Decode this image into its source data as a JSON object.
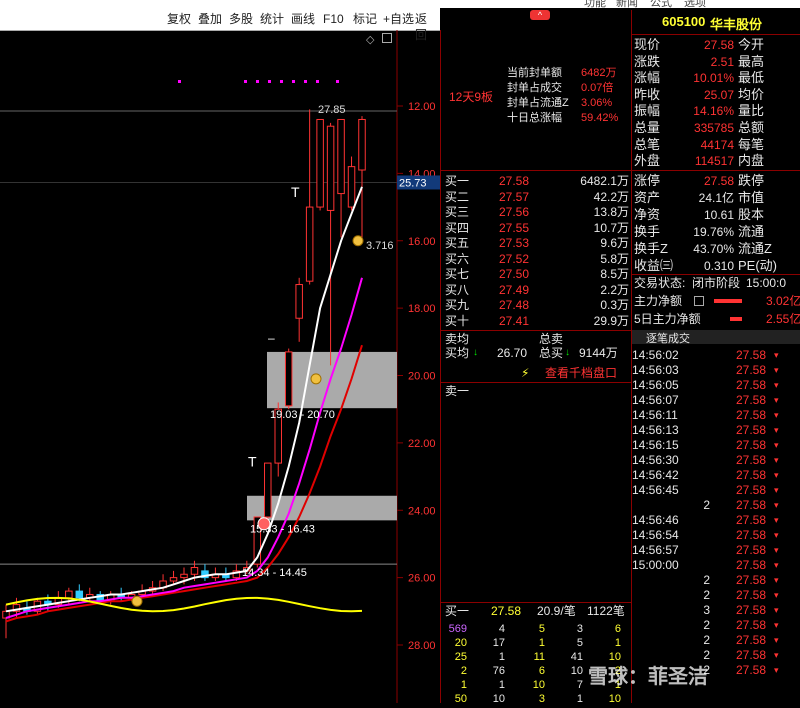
{
  "top_menu": [
    "功能",
    "新闻",
    "公式",
    "选项"
  ],
  "toolbar": {
    "items": [
      "复权",
      "叠加",
      "多股",
      "统计",
      "画线",
      "F10",
      "标记",
      "+自选",
      "返回"
    ]
  },
  "chart": {
    "y_ticks": [
      "28.00",
      "26.00",
      "24.00",
      "22.00",
      "20.00",
      "18.00",
      "16.00",
      "14.00",
      "12.00"
    ],
    "current_price_tag": "25.73",
    "high_label": "27.85",
    "label_3716": "3.716",
    "zone1_label": "19.03 - 20.70",
    "zone2_label": "15.33 - 16.43",
    "zone3_label": "14.34 - 14.45",
    "marker_T": "T",
    "marker_dash": "–",
    "glyph_diamond": "◇",
    "glyph_caret": "^"
  },
  "chart_data": {
    "type": "candlestick",
    "ylim": [
      11.5,
      29
    ],
    "y_ticks": [
      12,
      14,
      16,
      18,
      20,
      22,
      24,
      26,
      28
    ],
    "candles": [
      [
        12.8,
        13.0,
        12.2,
        13.2
      ],
      [
        13.0,
        13.2,
        12.8,
        13.4
      ],
      [
        13.1,
        13.0,
        12.9,
        13.3
      ],
      [
        13.0,
        13.3,
        12.9,
        13.4
      ],
      [
        13.3,
        13.2,
        13.0,
        13.5
      ],
      [
        13.2,
        13.4,
        13.1,
        13.6
      ],
      [
        13.4,
        13.6,
        13.2,
        13.7
      ],
      [
        13.6,
        13.4,
        13.3,
        13.8
      ],
      [
        13.4,
        13.5,
        13.3,
        13.7
      ],
      [
        13.5,
        13.3,
        13.2,
        13.6
      ],
      [
        13.3,
        13.5,
        13.2,
        13.6
      ],
      [
        13.5,
        13.4,
        13.3,
        13.7
      ],
      [
        13.4,
        13.5,
        13.3,
        13.6
      ],
      [
        13.5,
        13.6,
        13.4,
        13.8
      ],
      [
        13.6,
        13.7,
        13.5,
        13.9
      ],
      [
        13.7,
        13.9,
        13.6,
        14.1
      ],
      [
        13.9,
        14.0,
        13.8,
        14.2
      ],
      [
        14.0,
        14.1,
        13.8,
        14.3
      ],
      [
        14.1,
        14.3,
        13.9,
        14.5
      ],
      [
        14.2,
        14.0,
        13.9,
        14.4
      ],
      [
        14.0,
        14.1,
        13.9,
        14.3
      ],
      [
        14.1,
        14.0,
        13.9,
        14.3
      ],
      [
        14.0,
        14.2,
        13.9,
        14.4
      ],
      [
        14.2,
        14.3,
        14.1,
        14.5
      ],
      [
        14.4,
        15.8,
        14.3,
        15.8
      ],
      [
        15.8,
        17.4,
        15.7,
        17.4
      ],
      [
        17.4,
        19.0,
        17.0,
        19.2
      ],
      [
        19.1,
        20.7,
        19.0,
        20.8
      ],
      [
        21.7,
        22.7,
        21.0,
        22.9
      ],
      [
        22.8,
        25.0,
        22.7,
        27.9
      ],
      [
        25.0,
        27.6,
        24.9,
        27.6
      ],
      [
        24.9,
        27.4,
        20.3,
        27.5
      ],
      [
        25.4,
        27.6,
        24.1,
        27.6
      ],
      [
        25.0,
        26.2,
        24.9,
        26.5
      ],
      [
        26.1,
        27.6,
        24.0,
        27.7
      ]
    ],
    "ma_white": [
      13.0,
      13.05,
      13.1,
      13.15,
      13.2,
      13.25,
      13.3,
      13.35,
      13.4,
      13.45,
      13.5,
      13.5,
      13.55,
      13.6,
      13.65,
      13.7,
      13.8,
      13.9,
      14.0,
      14.05,
      14.1,
      14.1,
      14.15,
      14.2,
      14.6,
      15.3,
      16.2,
      17.3,
      18.6,
      20.3,
      22.0,
      23.0,
      24.0,
      24.8,
      25.6
    ],
    "ma_magenta": [
      12.8,
      12.9,
      13.0,
      13.05,
      13.1,
      13.15,
      13.2,
      13.25,
      13.3,
      13.3,
      13.35,
      13.4,
      13.4,
      13.45,
      13.5,
      13.55,
      13.6,
      13.7,
      13.75,
      13.8,
      13.85,
      13.9,
      13.95,
      14.0,
      14.2,
      14.6,
      15.2,
      15.9,
      16.8,
      17.8,
      18.9,
      19.9,
      20.8,
      21.8,
      22.9
    ],
    "ma_red": [
      12.7,
      12.8,
      12.85,
      12.9,
      13.0,
      13.05,
      13.1,
      13.15,
      13.2,
      13.25,
      13.3,
      13.3,
      13.35,
      13.4,
      13.45,
      13.5,
      13.55,
      13.6,
      13.65,
      13.7,
      13.75,
      13.8,
      13.85,
      13.9,
      14.0,
      14.3,
      14.7,
      15.2,
      15.8,
      16.5,
      17.3,
      18.2,
      19.0,
      19.9,
      20.9
    ]
  },
  "mid": {
    "board_days": "12天9板",
    "info": [
      {
        "label": "当前封单额",
        "value": "6482万"
      },
      {
        "label": "封单占成交",
        "value": "0.07倍"
      },
      {
        "label": "封单占流通Z",
        "value": "3.06%"
      },
      {
        "label": "十日总涨幅",
        "value": "59.42%"
      }
    ],
    "bids": [
      {
        "name": "买一",
        "price": "27.58",
        "vol": "6482.1万"
      },
      {
        "name": "买二",
        "price": "27.57",
        "vol": "42.2万"
      },
      {
        "name": "买三",
        "price": "27.56",
        "vol": "13.8万"
      },
      {
        "name": "买四",
        "price": "27.55",
        "vol": "10.7万"
      },
      {
        "name": "买五",
        "price": "27.53",
        "vol": "9.6万"
      },
      {
        "name": "买六",
        "price": "27.52",
        "vol": "5.8万"
      },
      {
        "name": "买七",
        "price": "27.50",
        "vol": "8.5万"
      },
      {
        "name": "买八",
        "price": "27.49",
        "vol": "2.2万"
      },
      {
        "name": "买九",
        "price": "27.48",
        "vol": "0.3万"
      },
      {
        "name": "买十",
        "price": "27.41",
        "vol": "29.9万"
      }
    ],
    "sell_avg": "卖均",
    "buy_avg": "买均",
    "buy_avg_value": "26.70",
    "total_sell": "总卖",
    "total_buy": "总买",
    "total_buy_value": "9144万",
    "view_orders": "查看千档盘口",
    "sell1": "卖一",
    "bottom_buy1": {
      "name": "买一",
      "price": "27.58",
      "vol": "20.9/笔",
      "count": "1122笔"
    },
    "queue": [
      [
        "569",
        "4",
        "5",
        "3",
        "6"
      ],
      [
        "20",
        "17",
        "1",
        "5",
        "1"
      ],
      [
        "25",
        "1",
        "11",
        "41",
        "10"
      ],
      [
        "2",
        "76",
        "6",
        "10",
        "2"
      ],
      [
        "1",
        "1",
        "10",
        "7",
        "1"
      ],
      [
        "50",
        "10",
        "3",
        "1",
        "10"
      ]
    ]
  },
  "right": {
    "code": "605100",
    "name": "华丰股份",
    "quote": [
      {
        "l": "现价",
        "v": "27.58",
        "r": "今开"
      },
      {
        "l": "涨跌",
        "v": "2.51",
        "r": "最高"
      },
      {
        "l": "涨幅",
        "v": "10.01%",
        "r": "最低"
      },
      {
        "l": "昨收",
        "v": "25.07",
        "r": "均价"
      },
      {
        "l": "振幅",
        "v": "14.16%",
        "r": "量比"
      },
      {
        "l": "总量",
        "v": "335785",
        "r": "总额"
      },
      {
        "l": "总笔",
        "v": "44174",
        "r": "每笔"
      },
      {
        "l": "外盘",
        "v": "114517",
        "r": "内盘"
      }
    ],
    "fund": [
      {
        "l": "涨停",
        "v": "27.58",
        "r": "跌停"
      },
      {
        "l": "资产",
        "v": "24.1亿",
        "r": "市值"
      },
      {
        "l": "净资",
        "v": "10.61",
        "r": "股本"
      },
      {
        "l": "换手",
        "v": "19.76%",
        "r": "流通"
      },
      {
        "l": "换手Z",
        "v": "43.70%",
        "r": "流通Z"
      },
      {
        "l": "收益㈢",
        "v": "0.310",
        "r": "PE(动)"
      }
    ],
    "status_label": "交易状态:",
    "status_value": "闭市阶段",
    "status_time": "15:00:0",
    "main_net": "主力净额",
    "main_net_value": "3.02亿",
    "main_net_5": "5日主力净额",
    "main_net_5_value": "2.55亿",
    "ticks_title": "逐笔成交",
    "ticks": [
      {
        "t": "14:56:02",
        "p": "27.58"
      },
      {
        "t": "14:56:03",
        "p": "27.58"
      },
      {
        "t": "14:56:05",
        "p": "27.58"
      },
      {
        "t": "14:56:07",
        "p": "27.58"
      },
      {
        "t": "14:56:11",
        "p": "27.58"
      },
      {
        "t": "14:56:13",
        "p": "27.58"
      },
      {
        "t": "14:56:15",
        "p": "27.58"
      },
      {
        "t": "14:56:30",
        "p": "27.58"
      },
      {
        "t": "14:56:42",
        "p": "27.58"
      },
      {
        "t": "14:56:45",
        "p": "27.58"
      },
      {
        "t": "2",
        "p": "27.58"
      },
      {
        "t": "14:56:46",
        "p": "27.58"
      },
      {
        "t": "14:56:54",
        "p": "27.58"
      },
      {
        "t": "14:56:57",
        "p": "27.58"
      },
      {
        "t": "15:00:00",
        "p": "27.58"
      },
      {
        "t": "2",
        "p": "27.58"
      },
      {
        "t": "2",
        "p": "27.58"
      },
      {
        "t": "3",
        "p": "27.58"
      },
      {
        "t": "2",
        "p": "27.58"
      },
      {
        "t": "2",
        "p": "27.58"
      },
      {
        "t": "2",
        "p": "27.58"
      },
      {
        "t": "2",
        "p": "27.58"
      }
    ],
    "watermark": "雪球：菲圣洁"
  }
}
